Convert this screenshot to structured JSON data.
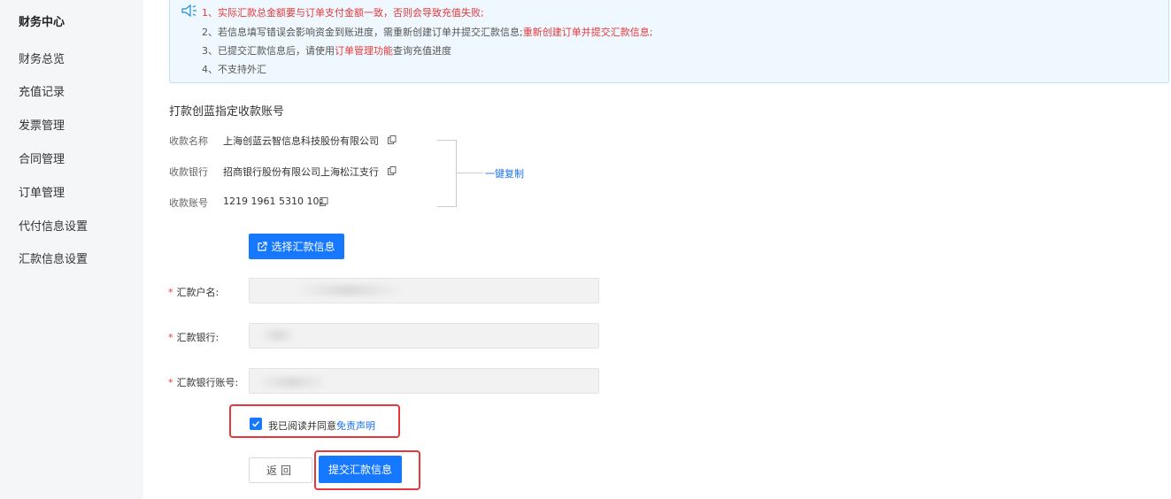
{
  "sidebar": {
    "title": "财务中心",
    "items": [
      {
        "label": "财务总览"
      },
      {
        "label": "充值记录"
      },
      {
        "label": "发票管理"
      },
      {
        "label": "合同管理"
      },
      {
        "label": "订单管理"
      },
      {
        "label": "代付信息设置"
      },
      {
        "label": "汇款信息设置"
      }
    ]
  },
  "notice": {
    "line1_red": "1、实际汇款总金额要与订单支付金额一致，否则会导致充值失败;",
    "line2_prefix": "2、若信息填写错误会影响资金到账进度，需重新创建订单并提交汇款信息;",
    "line2_red": "重新创建订单并提交汇款信息;",
    "line3_prefix": "3、已提交汇款信息后，请使用",
    "line3_red": "订单管理功能",
    "line3_suffix": "查询充值进度",
    "line4": "4、不支持外汇"
  },
  "account": {
    "section_title": "打款创蓝指定收款账号",
    "rows": [
      {
        "label": "收款名称",
        "value": "上海创蓝云智信息科技股份有限公司"
      },
      {
        "label": "收款银行",
        "value": "招商银行股份有限公司上海松江支行"
      },
      {
        "label": "收款账号",
        "value": "1219 1961 5310 102"
      }
    ],
    "copy_all": "一键复制"
  },
  "select_button": "选择汇款信息",
  "form": {
    "fields": [
      {
        "label": "汇款户名:",
        "value": ""
      },
      {
        "label": "汇款银行:",
        "value": ""
      },
      {
        "label": "汇款银行账号:",
        "value": ""
      }
    ]
  },
  "agreement": {
    "checked": true,
    "text": "我已阅读并同意",
    "link": "免责声明"
  },
  "buttons": {
    "back": "返回",
    "submit": "提交汇款信息"
  },
  "colors": {
    "primary": "#1677ff",
    "danger": "#e4393c",
    "notice_bg": "#eef8fe"
  }
}
